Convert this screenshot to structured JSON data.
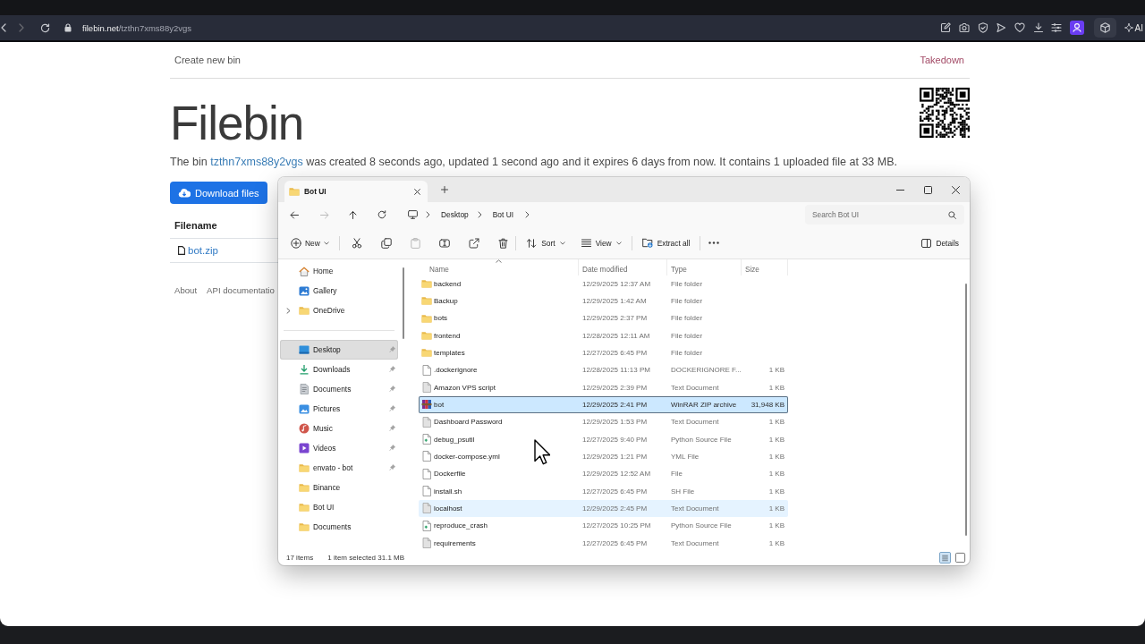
{
  "browser": {
    "url": "**filebin.net**/tzthn7xms88y2vgs",
    "ai_label": "AI"
  },
  "page": {
    "nav": {
      "create_link": "Create new bin",
      "takedown_link": "Takedown"
    },
    "title": "Filebin",
    "summary": {
      "lead": "The bin",
      "bin_id": "tzthn7xms88y2vgs",
      "rest": "was created 8 seconds ago, updated 1 second ago and it expires 6 days from now. It contains 1 uploaded file at 33 MB."
    },
    "download_button": "Download files",
    "files_table": {
      "columns": [
        "Filename"
      ],
      "rows": [
        {
          "name": "bot.zip"
        }
      ]
    },
    "footer_links": [
      "About",
      "API documentatio"
    ]
  },
  "explorer": {
    "tabs": [
      {
        "title": "Bot UI",
        "selected": true
      }
    ],
    "nav_buttons": [
      {
        "kind": "back",
        "disabled": false
      },
      {
        "kind": "forward",
        "disabled": true
      },
      {
        "kind": "up",
        "disabled": false
      },
      {
        "kind": "refresh",
        "disabled": false
      }
    ],
    "breadcrumb": [
      "Desktop",
      "Bot UI"
    ],
    "search": {
      "placeholder": "Search Bot UI"
    },
    "command_groups": [
      [
        {
          "kind": "new",
          "label": "New",
          "dropdown": true,
          "disabled": false
        }
      ],
      [
        {
          "kind": "cut",
          "disabled": false
        },
        {
          "kind": "copy",
          "disabled": false
        },
        {
          "kind": "paste",
          "disabled": true
        },
        {
          "kind": "rename",
          "disabled": false
        },
        {
          "kind": "share",
          "disabled": false
        },
        {
          "kind": "delete",
          "disabled": false
        }
      ],
      [
        {
          "kind": "sort",
          "label": "Sort",
          "dropdown": true,
          "disabled": false
        },
        {
          "kind": "view",
          "label": "View",
          "dropdown": true,
          "disabled": false
        }
      ],
      [
        {
          "kind": "extract",
          "label": "Extract all",
          "dropdown": false,
          "disabled": false
        }
      ],
      [
        {
          "kind": "more",
          "disabled": false
        }
      ]
    ],
    "details_button": "Details",
    "nav_pane": {
      "sections": [
        {
          "items": [
            {
              "kind": "home",
              "label": "Home",
              "expandable": false,
              "pinned": false,
              "selected": false
            },
            {
              "kind": "gallery",
              "label": "Gallery",
              "expandable": false,
              "pinned": false,
              "selected": false
            },
            {
              "kind": "folder",
              "label": "OneDrive",
              "expandable": true,
              "pinned": false,
              "selected": false
            }
          ]
        },
        {
          "items": [
            {
              "kind": "desktop",
              "label": "Desktop",
              "expandable": false,
              "pinned": true,
              "selected": true
            },
            {
              "kind": "downloads",
              "label": "Downloads",
              "expandable": false,
              "pinned": true,
              "selected": false
            },
            {
              "kind": "documents",
              "label": "Documents",
              "expandable": false,
              "pinned": true,
              "selected": false
            },
            {
              "kind": "pictures",
              "label": "Pictures",
              "expandable": false,
              "pinned": true,
              "selected": false
            },
            {
              "kind": "music",
              "label": "Music",
              "expandable": false,
              "pinned": true,
              "selected": false
            },
            {
              "kind": "videos",
              "label": "Videos",
              "expandable": false,
              "pinned": true,
              "selected": false
            },
            {
              "kind": "folder",
              "label": "envato - bot",
              "expandable": false,
              "pinned": true,
              "selected": false
            },
            {
              "kind": "folder",
              "label": "Binance",
              "expandable": false,
              "pinned": false,
              "selected": false
            },
            {
              "kind": "folder",
              "label": "Bot UI",
              "expandable": false,
              "pinned": false,
              "selected": false
            },
            {
              "kind": "folder",
              "label": "Documents",
              "expandable": false,
              "pinned": false,
              "selected": false
            }
          ]
        }
      ]
    },
    "files": {
      "columns": [
        {
          "label": "Name",
          "sorted": true
        },
        {
          "label": "Date modified",
          "sorted": false
        },
        {
          "label": "Type",
          "sorted": false
        },
        {
          "label": "Size",
          "sorted": false
        }
      ],
      "rows": [
        {
          "kind": "folder",
          "name": "backend",
          "date": "12/29/2025 12:37 AM",
          "type": "File folder",
          "selected": false,
          "hovered": false
        },
        {
          "kind": "folder",
          "name": "Backup",
          "date": "12/29/2025 1:42 AM",
          "type": "File folder",
          "selected": false,
          "hovered": false
        },
        {
          "kind": "folder",
          "name": "bots",
          "date": "12/29/2025 2:37 PM",
          "type": "File folder",
          "selected": false,
          "hovered": false
        },
        {
          "kind": "folder",
          "name": "frontend",
          "date": "12/28/2025 12:11 AM",
          "type": "File folder",
          "selected": false,
          "hovered": false
        },
        {
          "kind": "folder",
          "name": "templates",
          "date": "12/27/2025 6:45 PM",
          "type": "File folder",
          "selected": false,
          "hovered": false
        },
        {
          "kind": "file",
          "name": ".dockerignore",
          "date": "12/28/2025 11:13 PM",
          "type": "DOCKERIGNORE F...",
          "size": "1 KB",
          "selected": false,
          "hovered": false
        },
        {
          "kind": "text",
          "name": "Amazon VPS script",
          "date": "12/29/2025 2:39 PM",
          "type": "Text Document",
          "size": "1 KB",
          "selected": false,
          "hovered": false
        },
        {
          "kind": "archive",
          "name": "bot",
          "date": "12/29/2025 2:41 PM",
          "type": "WinRAR ZIP archive",
          "size": "31,948 KB",
          "selected": true,
          "hovered": false
        },
        {
          "kind": "text",
          "name": "Dashboard Password",
          "date": "12/29/2025 1:53 PM",
          "type": "Text Document",
          "size": "1 KB",
          "selected": false,
          "hovered": false
        },
        {
          "kind": "python",
          "name": "debug_psutil",
          "date": "12/27/2025 9:40 PM",
          "type": "Python Source File",
          "size": "1 KB",
          "selected": false,
          "hovered": false
        },
        {
          "kind": "file",
          "name": "docker-compose.yml",
          "date": "12/29/2025 1:21 PM",
          "type": "YML File",
          "size": "1 KB",
          "selected": false,
          "hovered": false
        },
        {
          "kind": "file",
          "name": "Dockerfile",
          "date": "12/29/2025 12:52 AM",
          "type": "File",
          "size": "1 KB",
          "selected": false,
          "hovered": false
        },
        {
          "kind": "file",
          "name": "install.sh",
          "date": "12/27/2025 6:45 PM",
          "type": "SH File",
          "size": "1 KB",
          "selected": false,
          "hovered": false
        },
        {
          "kind": "text",
          "name": "localhost",
          "date": "12/29/2025 2:45 PM",
          "type": "Text Document",
          "size": "1 KB",
          "selected": false,
          "hovered": true
        },
        {
          "kind": "python",
          "name": "reproduce_crash",
          "date": "12/27/2025 10:25 PM",
          "type": "Python Source File",
          "size": "1 KB",
          "selected": false,
          "hovered": false
        },
        {
          "kind": "text",
          "name": "requirements",
          "date": "12/27/2025 6:45 PM",
          "type": "Text Document",
          "size": "1 KB",
          "selected": false,
          "hovered": false
        }
      ]
    },
    "status": {
      "item_count": "17 items",
      "selection": "1 item selected 31.1 MB"
    },
    "view_modes": [
      {
        "kind": "details",
        "selected": true
      },
      {
        "kind": "tiles",
        "selected": false
      }
    ]
  }
}
